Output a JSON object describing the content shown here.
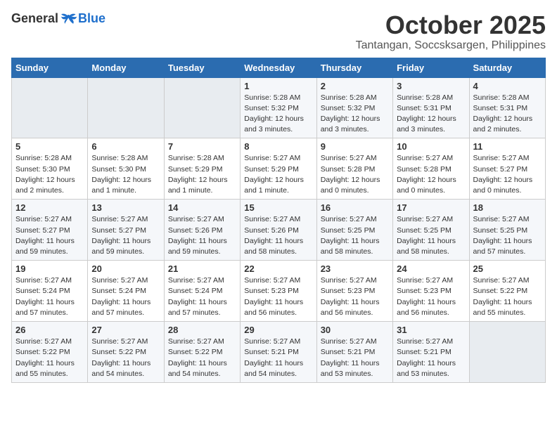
{
  "logo": {
    "general": "General",
    "blue": "Blue"
  },
  "title": "October 2025",
  "location": "Tantangan, Soccsksargen, Philippines",
  "weekdays": [
    "Sunday",
    "Monday",
    "Tuesday",
    "Wednesday",
    "Thursday",
    "Friday",
    "Saturday"
  ],
  "weeks": [
    [
      {
        "day": null
      },
      {
        "day": null
      },
      {
        "day": null
      },
      {
        "day": "1",
        "sunrise": "Sunrise: 5:28 AM",
        "sunset": "Sunset: 5:32 PM",
        "daylight": "Daylight: 12 hours and 3 minutes."
      },
      {
        "day": "2",
        "sunrise": "Sunrise: 5:28 AM",
        "sunset": "Sunset: 5:32 PM",
        "daylight": "Daylight: 12 hours and 3 minutes."
      },
      {
        "day": "3",
        "sunrise": "Sunrise: 5:28 AM",
        "sunset": "Sunset: 5:31 PM",
        "daylight": "Daylight: 12 hours and 3 minutes."
      },
      {
        "day": "4",
        "sunrise": "Sunrise: 5:28 AM",
        "sunset": "Sunset: 5:31 PM",
        "daylight": "Daylight: 12 hours and 2 minutes."
      }
    ],
    [
      {
        "day": "5",
        "sunrise": "Sunrise: 5:28 AM",
        "sunset": "Sunset: 5:30 PM",
        "daylight": "Daylight: 12 hours and 2 minutes."
      },
      {
        "day": "6",
        "sunrise": "Sunrise: 5:28 AM",
        "sunset": "Sunset: 5:30 PM",
        "daylight": "Daylight: 12 hours and 1 minute."
      },
      {
        "day": "7",
        "sunrise": "Sunrise: 5:28 AM",
        "sunset": "Sunset: 5:29 PM",
        "daylight": "Daylight: 12 hours and 1 minute."
      },
      {
        "day": "8",
        "sunrise": "Sunrise: 5:27 AM",
        "sunset": "Sunset: 5:29 PM",
        "daylight": "Daylight: 12 hours and 1 minute."
      },
      {
        "day": "9",
        "sunrise": "Sunrise: 5:27 AM",
        "sunset": "Sunset: 5:28 PM",
        "daylight": "Daylight: 12 hours and 0 minutes."
      },
      {
        "day": "10",
        "sunrise": "Sunrise: 5:27 AM",
        "sunset": "Sunset: 5:28 PM",
        "daylight": "Daylight: 12 hours and 0 minutes."
      },
      {
        "day": "11",
        "sunrise": "Sunrise: 5:27 AM",
        "sunset": "Sunset: 5:27 PM",
        "daylight": "Daylight: 12 hours and 0 minutes."
      }
    ],
    [
      {
        "day": "12",
        "sunrise": "Sunrise: 5:27 AM",
        "sunset": "Sunset: 5:27 PM",
        "daylight": "Daylight: 11 hours and 59 minutes."
      },
      {
        "day": "13",
        "sunrise": "Sunrise: 5:27 AM",
        "sunset": "Sunset: 5:27 PM",
        "daylight": "Daylight: 11 hours and 59 minutes."
      },
      {
        "day": "14",
        "sunrise": "Sunrise: 5:27 AM",
        "sunset": "Sunset: 5:26 PM",
        "daylight": "Daylight: 11 hours and 59 minutes."
      },
      {
        "day": "15",
        "sunrise": "Sunrise: 5:27 AM",
        "sunset": "Sunset: 5:26 PM",
        "daylight": "Daylight: 11 hours and 58 minutes."
      },
      {
        "day": "16",
        "sunrise": "Sunrise: 5:27 AM",
        "sunset": "Sunset: 5:25 PM",
        "daylight": "Daylight: 11 hours and 58 minutes."
      },
      {
        "day": "17",
        "sunrise": "Sunrise: 5:27 AM",
        "sunset": "Sunset: 5:25 PM",
        "daylight": "Daylight: 11 hours and 58 minutes."
      },
      {
        "day": "18",
        "sunrise": "Sunrise: 5:27 AM",
        "sunset": "Sunset: 5:25 PM",
        "daylight": "Daylight: 11 hours and 57 minutes."
      }
    ],
    [
      {
        "day": "19",
        "sunrise": "Sunrise: 5:27 AM",
        "sunset": "Sunset: 5:24 PM",
        "daylight": "Daylight: 11 hours and 57 minutes."
      },
      {
        "day": "20",
        "sunrise": "Sunrise: 5:27 AM",
        "sunset": "Sunset: 5:24 PM",
        "daylight": "Daylight: 11 hours and 57 minutes."
      },
      {
        "day": "21",
        "sunrise": "Sunrise: 5:27 AM",
        "sunset": "Sunset: 5:24 PM",
        "daylight": "Daylight: 11 hours and 57 minutes."
      },
      {
        "day": "22",
        "sunrise": "Sunrise: 5:27 AM",
        "sunset": "Sunset: 5:23 PM",
        "daylight": "Daylight: 11 hours and 56 minutes."
      },
      {
        "day": "23",
        "sunrise": "Sunrise: 5:27 AM",
        "sunset": "Sunset: 5:23 PM",
        "daylight": "Daylight: 11 hours and 56 minutes."
      },
      {
        "day": "24",
        "sunrise": "Sunrise: 5:27 AM",
        "sunset": "Sunset: 5:23 PM",
        "daylight": "Daylight: 11 hours and 56 minutes."
      },
      {
        "day": "25",
        "sunrise": "Sunrise: 5:27 AM",
        "sunset": "Sunset: 5:22 PM",
        "daylight": "Daylight: 11 hours and 55 minutes."
      }
    ],
    [
      {
        "day": "26",
        "sunrise": "Sunrise: 5:27 AM",
        "sunset": "Sunset: 5:22 PM",
        "daylight": "Daylight: 11 hours and 55 minutes."
      },
      {
        "day": "27",
        "sunrise": "Sunrise: 5:27 AM",
        "sunset": "Sunset: 5:22 PM",
        "daylight": "Daylight: 11 hours and 54 minutes."
      },
      {
        "day": "28",
        "sunrise": "Sunrise: 5:27 AM",
        "sunset": "Sunset: 5:22 PM",
        "daylight": "Daylight: 11 hours and 54 minutes."
      },
      {
        "day": "29",
        "sunrise": "Sunrise: 5:27 AM",
        "sunset": "Sunset: 5:21 PM",
        "daylight": "Daylight: 11 hours and 54 minutes."
      },
      {
        "day": "30",
        "sunrise": "Sunrise: 5:27 AM",
        "sunset": "Sunset: 5:21 PM",
        "daylight": "Daylight: 11 hours and 53 minutes."
      },
      {
        "day": "31",
        "sunrise": "Sunrise: 5:27 AM",
        "sunset": "Sunset: 5:21 PM",
        "daylight": "Daylight: 11 hours and 53 minutes."
      },
      {
        "day": null
      }
    ]
  ]
}
